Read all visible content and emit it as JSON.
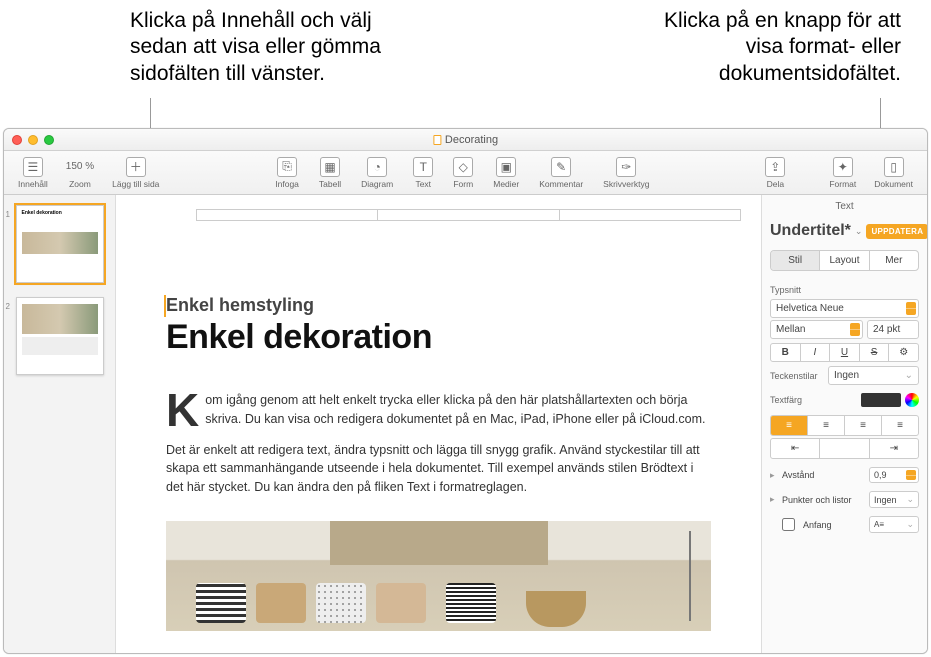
{
  "callouts": {
    "left": "Klicka på Innehåll och välj sedan att visa eller gömma sidofälten till vänster.",
    "right": "Klicka på en knapp för att visa format- eller dokumentsidofältet."
  },
  "window": {
    "title": "Decorating"
  },
  "toolbar": {
    "view": "Innehåll",
    "zoom_value": "150 %",
    "zoom": "Zoom",
    "add_page": "Lägg till sida",
    "insert": "Infoga",
    "table": "Tabell",
    "chart": "Diagram",
    "text": "Text",
    "shape": "Form",
    "media": "Medier",
    "comment": "Kommentar",
    "pen": "Skrivverktyg",
    "share": "Dela",
    "format": "Format",
    "document": "Dokument"
  },
  "thumbnails": {
    "n1": "1",
    "n2": "2"
  },
  "doc": {
    "subtitle": "Enkel hemstyling",
    "title": "Enkel dekoration",
    "dropcap": "K",
    "p1": "om igång genom att helt enkelt trycka eller klicka på den här platshållartexten och börja skriva. Du kan visa och redigera dokumentet på en Mac, iPad, iPhone eller på iCloud.com.",
    "p2": "Det är enkelt att redigera text, ändra typsnitt och lägga till snygg grafik. Använd styckestilar till att skapa ett sammanhängande utseende i hela dokumentet. Till exempel används stilen Brödtext i det här stycket. Du kan ändra den på fliken Text i formatreglagen."
  },
  "inspector": {
    "header": "Text",
    "style_name": "Undertitel*",
    "update": "UPPDATERA",
    "tab_style": "Stil",
    "tab_layout": "Layout",
    "tab_more": "Mer",
    "font_section": "Typsnitt",
    "font_family": "Helvetica Neue",
    "font_weight": "Mellan",
    "font_size": "24 pkt",
    "b": "B",
    "i": "I",
    "u": "U",
    "s": "S",
    "gear": "⚙",
    "char_styles": "Teckenstilar",
    "char_none": "Ingen",
    "text_color": "Textfärg",
    "spacing_lbl": "Avstånd",
    "spacing_val": "0,9",
    "bullets_lbl": "Punkter och listor",
    "bullets_val": "Ingen",
    "dropcap_lbl": "Anfang"
  }
}
